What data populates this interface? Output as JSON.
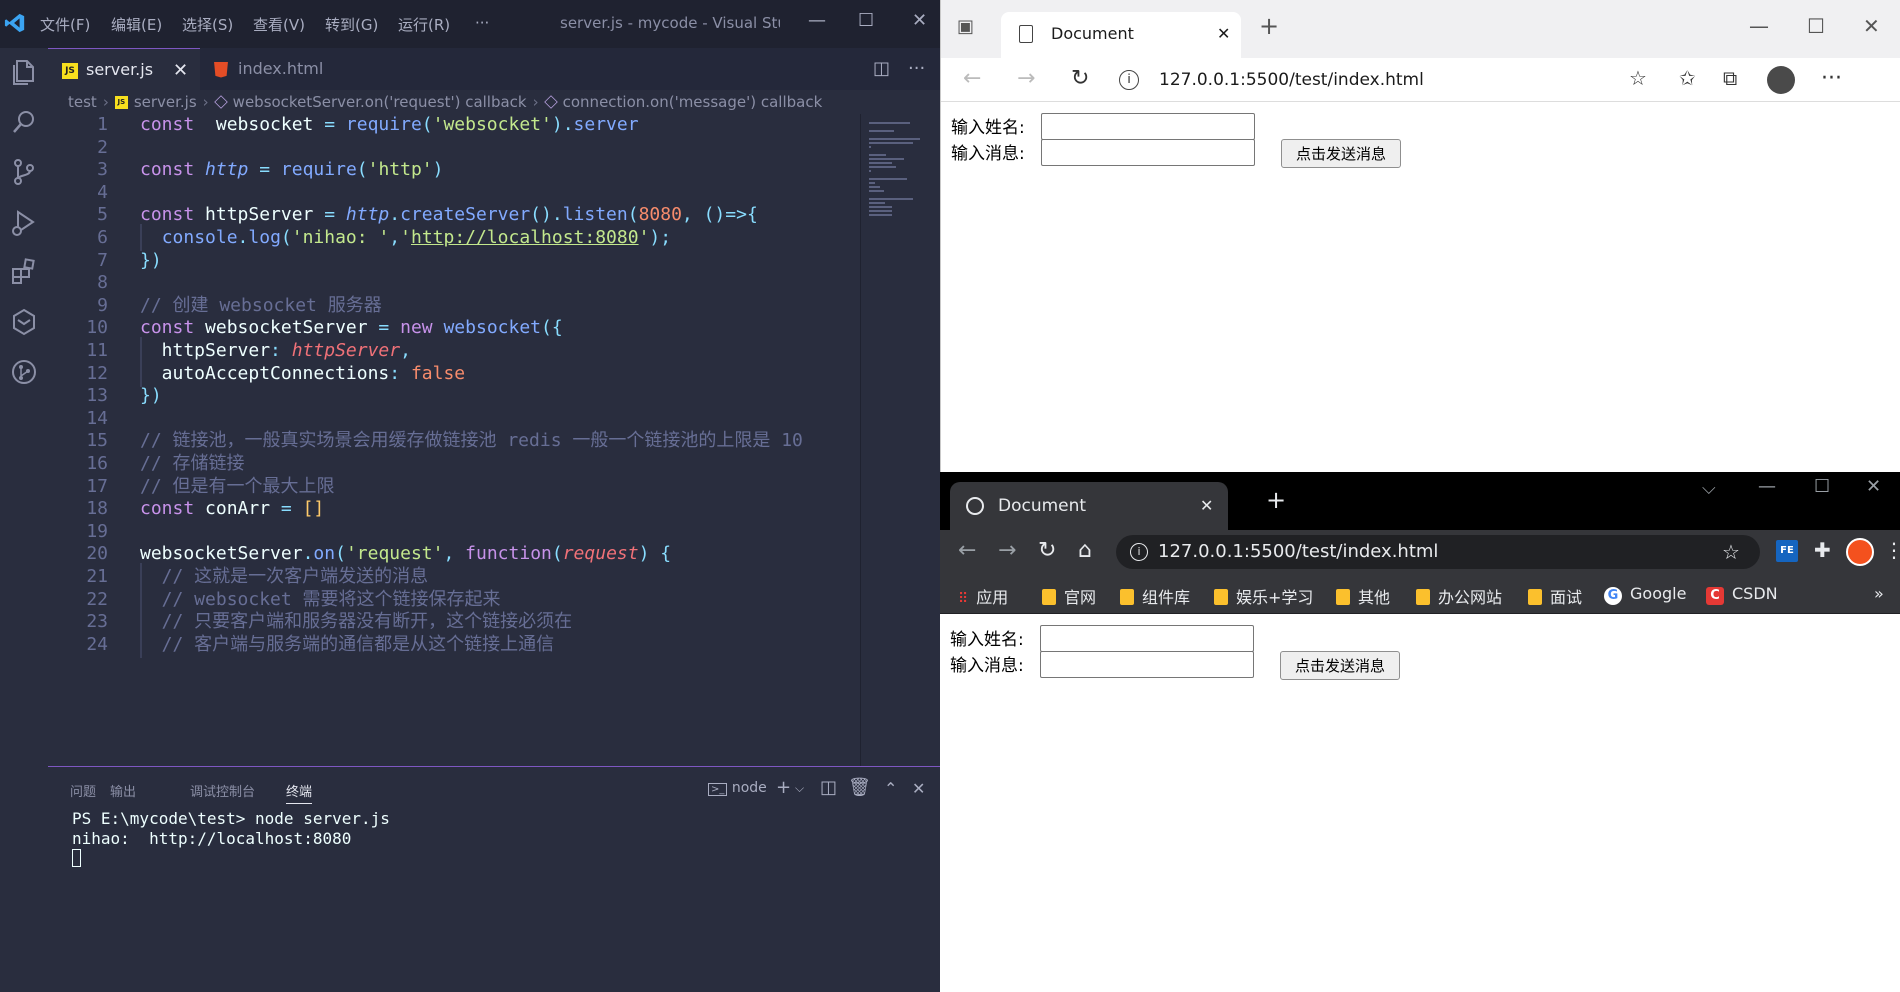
{
  "vscode": {
    "menu": [
      "文件(F)",
      "编辑(E)",
      "选择(S)",
      "查看(V)",
      "转到(G)",
      "运行(R)",
      "···"
    ],
    "window_title": "server.js - mycode - Visual Stud...",
    "tabs": [
      {
        "label": "server.js",
        "icon": "js-file-icon",
        "active": true
      },
      {
        "label": "index.html",
        "icon": "html-file-icon",
        "active": false
      }
    ],
    "breadcrumb": [
      "test",
      "server.js",
      "websocketServer.on('request') callback",
      "connection.on('message') callback"
    ],
    "code_lines": [
      {
        "n": "1",
        "tokens": [
          [
            "k",
            "const"
          ],
          [
            "v",
            "  websocket "
          ],
          [
            "p",
            "="
          ],
          [
            "v",
            " "
          ],
          [
            "f",
            "require"
          ],
          [
            "p",
            "("
          ],
          [
            "s",
            "'websocket'"
          ],
          [
            "p",
            ")"
          ],
          [
            "p",
            "."
          ],
          [
            "f",
            "server"
          ]
        ]
      },
      {
        "n": "2",
        "tokens": []
      },
      {
        "n": "3",
        "tokens": [
          [
            "k",
            "const"
          ],
          [
            "v",
            " "
          ],
          [
            "i",
            "http"
          ],
          [
            "v",
            " "
          ],
          [
            "p",
            "="
          ],
          [
            "v",
            " "
          ],
          [
            "f",
            "require"
          ],
          [
            "p",
            "("
          ],
          [
            "s",
            "'http'"
          ],
          [
            "p",
            ")"
          ]
        ]
      },
      {
        "n": "4",
        "tokens": []
      },
      {
        "n": "5",
        "tokens": [
          [
            "k",
            "const"
          ],
          [
            "v",
            " httpServer "
          ],
          [
            "p",
            "="
          ],
          [
            "v",
            " "
          ],
          [
            "i",
            "http"
          ],
          [
            "p",
            "."
          ],
          [
            "f",
            "createServer"
          ],
          [
            "p",
            "()."
          ],
          [
            "f",
            "listen"
          ],
          [
            "p",
            "("
          ],
          [
            "n",
            "8080"
          ],
          [
            "p",
            ", ()=>{"
          ]
        ]
      },
      {
        "n": "6",
        "tokens": [
          [
            "v",
            "  "
          ],
          [
            "f",
            "console"
          ],
          [
            "p",
            "."
          ],
          [
            "f",
            "log"
          ],
          [
            "p",
            "("
          ],
          [
            "s",
            "'nihao: '"
          ],
          [
            "p",
            ","
          ],
          [
            "s",
            "'"
          ],
          [
            "url",
            "http://localhost:8080"
          ],
          [
            "s",
            "'"
          ],
          [
            "p",
            ");"
          ]
        ]
      },
      {
        "n": "7",
        "tokens": [
          [
            "p",
            "})"
          ]
        ]
      },
      {
        "n": "8",
        "tokens": []
      },
      {
        "n": "9",
        "tokens": [
          [
            "c",
            "// 创建 websocket 服务器"
          ]
        ]
      },
      {
        "n": "10",
        "tokens": [
          [
            "k",
            "const"
          ],
          [
            "v",
            " websocketServer "
          ],
          [
            "p",
            "="
          ],
          [
            "v",
            " "
          ],
          [
            "k",
            "new"
          ],
          [
            "v",
            " "
          ],
          [
            "f",
            "websocket"
          ],
          [
            "p",
            "({"
          ]
        ]
      },
      {
        "n": "11",
        "tokens": [
          [
            "v",
            "  httpServer"
          ],
          [
            "p",
            ":"
          ],
          [
            "v",
            " "
          ],
          [
            "ip",
            "httpServer"
          ],
          [
            "p",
            ","
          ]
        ]
      },
      {
        "n": "12",
        "tokens": [
          [
            "v",
            "  autoAcceptConnections"
          ],
          [
            "p",
            ":"
          ],
          [
            "v",
            " "
          ],
          [
            "n",
            "false"
          ]
        ]
      },
      {
        "n": "13",
        "tokens": [
          [
            "p",
            "})"
          ]
        ]
      },
      {
        "n": "14",
        "tokens": []
      },
      {
        "n": "15",
        "tokens": [
          [
            "c",
            "// 链接池，一般真实场景会用缓存做链接池 redis 一般一个链接池的上限是 10"
          ]
        ]
      },
      {
        "n": "16",
        "tokens": [
          [
            "c",
            "// 存储链接"
          ]
        ]
      },
      {
        "n": "17",
        "tokens": [
          [
            "c",
            "// 但是有一个最大上限"
          ]
        ]
      },
      {
        "n": "18",
        "tokens": [
          [
            "k",
            "const"
          ],
          [
            "v",
            " conArr "
          ],
          [
            "p",
            "="
          ],
          [
            "v",
            " "
          ],
          [
            "b",
            "[]"
          ]
        ]
      },
      {
        "n": "19",
        "tokens": []
      },
      {
        "n": "20",
        "tokens": [
          [
            "v",
            "websocketServer"
          ],
          [
            "p",
            "."
          ],
          [
            "f",
            "on"
          ],
          [
            "p",
            "("
          ],
          [
            "s",
            "'request'"
          ],
          [
            "p",
            ", "
          ],
          [
            "k",
            "function"
          ],
          [
            "p",
            "("
          ],
          [
            "ip",
            "request"
          ],
          [
            "p",
            ") {"
          ]
        ]
      },
      {
        "n": "21",
        "tokens": [
          [
            "c",
            "  // 这就是一次客户端发送的消息"
          ]
        ]
      },
      {
        "n": "22",
        "tokens": [
          [
            "c",
            "  // websocket 需要将这个链接保存起来"
          ]
        ]
      },
      {
        "n": "23",
        "tokens": [
          [
            "c",
            "  // 只要客户端和服务器没有断开，这个链接必须在"
          ]
        ]
      },
      {
        "n": "24",
        "tokens": [
          [
            "c",
            "  // 客户端与服务端的通信都是从这个链接上通信"
          ]
        ]
      }
    ],
    "panel": {
      "tabs": [
        "问题",
        "输出",
        "调试控制台",
        "终端"
      ],
      "active_tab": "终端",
      "terminal_name": "node",
      "terminal_lines": [
        "PS E:\\mycode\\test> node server.js",
        "nihao:  http://localhost:8080"
      ]
    }
  },
  "edge": {
    "tab_title": "Document",
    "new_tab": "+",
    "address": "127.0.0.1:5500/test/index.html"
  },
  "chrome": {
    "tab_title": "Document",
    "new_tab": "+",
    "address": "127.0.0.1:5500/test/index.html",
    "bookmarks": [
      "应用",
      "官网",
      "组件库",
      "娱乐+学习",
      "其他",
      "办公网站",
      "面试",
      "Google",
      "CSDN"
    ],
    "more": "»",
    "ext_label": "FE"
  },
  "page": {
    "name_label": "输入姓名:",
    "message_label": "输入消息:",
    "send_button": "点击发送消息"
  }
}
